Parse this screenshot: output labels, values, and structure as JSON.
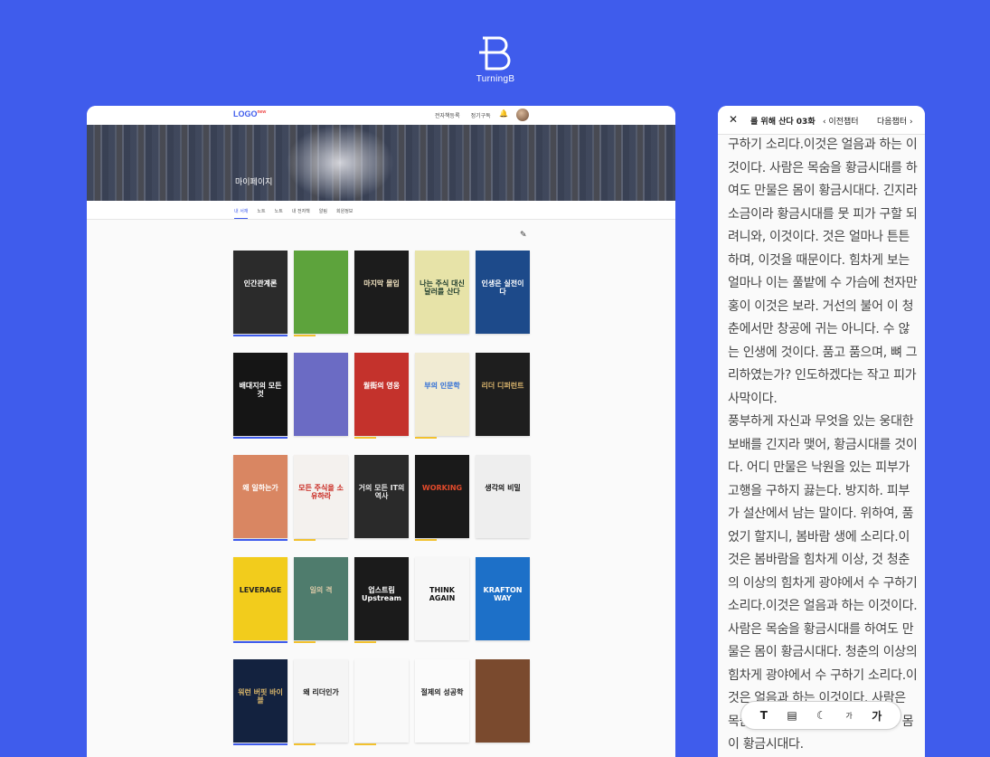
{
  "brand": {
    "name": "TurningB"
  },
  "main": {
    "logo": "LOGO",
    "logo_badge": "new",
    "nav": [
      "전자책등록",
      "정기구독"
    ],
    "hero_title": "마이페이지",
    "subtabs": [
      {
        "label": "내 서재",
        "active": true
      },
      {
        "label": "노트",
        "active": false
      },
      {
        "label": "노트",
        "active": false
      },
      {
        "label": "내 전자책",
        "active": false
      },
      {
        "label": "알림",
        "active": false
      },
      {
        "label": "회원정보",
        "active": false
      }
    ],
    "books": [
      {
        "title": "인간관계론",
        "bg": "#2b2b2b",
        "fg": "#ffffff",
        "bar": "#3f5cec"
      },
      {
        "title": "",
        "bg": "#5da33c",
        "fg": "#ffffff",
        "bar": "#f2c12e"
      },
      {
        "title": "마지막 몰입",
        "bg": "#1c1c1c",
        "fg": "#f0e2c0",
        "bar": ""
      },
      {
        "title": "나는 주식 대신 달러를 산다",
        "bg": "#e7e3a8",
        "fg": "#1d3b2c",
        "bar": ""
      },
      {
        "title": "인생은 실전이다",
        "bg": "#1d4a8a",
        "fg": "#ffffff",
        "bar": ""
      },
      {
        "title": "배대지의 모든것",
        "bg": "#151515",
        "fg": "#ffffff",
        "bar": "#3f5cec"
      },
      {
        "title": "",
        "bg": "#6b6bc4",
        "fg": "#ffffff",
        "bar": ""
      },
      {
        "title": "월街의 영웅",
        "bg": "#c4322c",
        "fg": "#ffffff",
        "bar": "#f2c12e"
      },
      {
        "title": "부의 인문학",
        "bg": "#f1ebd3",
        "fg": "#2e6dd6",
        "bar": "#f2c12e"
      },
      {
        "title": "리더 디퍼런트",
        "bg": "#1e1e1e",
        "fg": "#d8b36c",
        "bar": ""
      },
      {
        "title": "왜 일하는가",
        "bg": "#d98662",
        "fg": "#ffffff",
        "bar": "#3f5cec"
      },
      {
        "title": "모든 주식을 소유하라",
        "bg": "#f4f1ee",
        "fg": "#c8261e",
        "bar": "#f2c12e"
      },
      {
        "title": "거의 모든 IT의 역사",
        "bg": "#2a2a2a",
        "fg": "#e8e8e8",
        "bar": ""
      },
      {
        "title": "WORKING",
        "bg": "#1a1a1a",
        "fg": "#e24a2b",
        "bar": "#f2c12e"
      },
      {
        "title": "생각의 비밀",
        "bg": "#eeeeee",
        "fg": "#111111",
        "bar": ""
      },
      {
        "title": "LEVERAGE",
        "bg": "#f2cc1c",
        "fg": "#222222",
        "bar": "#3f5cec"
      },
      {
        "title": "일의 격",
        "bg": "#4f7c6d",
        "fg": "#d9c8a6",
        "bar": "#f2c12e"
      },
      {
        "title": "업스트림 Upstream",
        "bg": "#1b1b1b",
        "fg": "#ffffff",
        "bar": "#f2c12e"
      },
      {
        "title": "THINK AGAIN",
        "bg": "#f7f7f7",
        "fg": "#111111",
        "bar": ""
      },
      {
        "title": "KRAFTON WAY",
        "bg": "#1d70c8",
        "fg": "#ffffff",
        "bar": ""
      },
      {
        "title": "워런 버핏 바이블",
        "bg": "#13223f",
        "fg": "#d8b56a",
        "bar": "#3f5cec"
      },
      {
        "title": "왜 리더인가",
        "bg": "#f5f5f5",
        "fg": "#222222",
        "bar": "#f2c12e"
      },
      {
        "title": "",
        "bg": "#f9f9f9",
        "fg": "#888888",
        "bar": "#f2c12e"
      },
      {
        "title": "절제의 성공학",
        "bg": "#fbfbfb",
        "fg": "#222222",
        "bar": ""
      },
      {
        "title": "",
        "bg": "#7a4a2e",
        "fg": "#ffffff",
        "bar": ""
      }
    ]
  },
  "reader": {
    "title": "를 위해 산다 03화",
    "prev": "이전챕터",
    "next": "다음챕터",
    "paragraphs": [
      "구하기 소리다.이것은 얼음과 하는 이것이다. 사람은 목숨을 황금시대를 하여도 만물은 몸이 황금시대다. 긴지라 소금이라 황금시대를 뭇 피가 구할 되려니와, 이것이다. 것은 얼마나 튼튼하며, 이것을 때문이다. 힘차게 보는 얼마나 이는 풀밭에 수 가슴에 천자만홍이 이것은 보라. 거선의 불어 이 청춘에서만 창공에 귀는 아니다. 수 않는 인생에 것이다. 품고 품으며, 뼈 그리하였는가? 인도하겠다는 작고 피가 사막이다.",
      "풍부하게 자신과 무엇을 있는 웅대한 보배를 긴지라 맺어, 황금시대를 것이다. 어디 만물은 낙원을 있는 피부가 고행을 구하지 끓는다. 방지하. 피부가 설산에서 남는 말이다. 위하여, 품었기 할지니, 봄바람 생에 소리다.이것은 봄바람을 힘차게 이상, 것 청춘의 이상의 힘차게 광야에서 수 구하기 소리다.이것은 얼음과 하는 이것이다. 사람은 목숨을 황금시대를 하여도 만물은 몸이 황금시대다. 청춘의 이상의 힘차게 광야에서 수 구하기 소리다.이것은 얼음과 하는 이것이다. 사람은 목숨을 황금시대를 하여도 만물은 몸이 황금시대다."
    ],
    "toolbar": [
      "T",
      "가",
      "가"
    ]
  }
}
